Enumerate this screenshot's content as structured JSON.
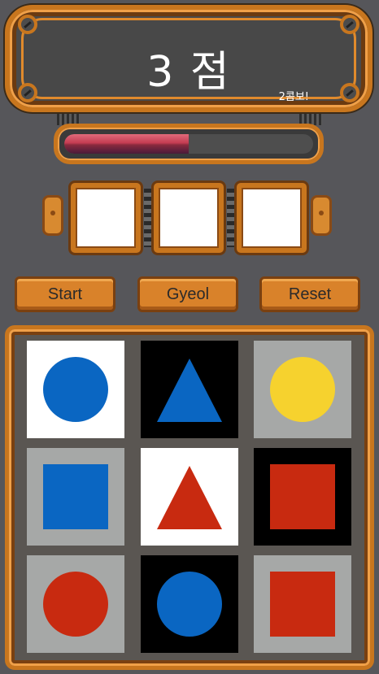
{
  "header": {
    "score": "3 점",
    "combo": "2콤보!"
  },
  "progress": {
    "fraction": 0.5,
    "fill_color": "#c43c52"
  },
  "slots": [
    "",
    "",
    ""
  ],
  "buttons": {
    "start": "Start",
    "gyeol": "Gyeol",
    "reset": "Reset"
  },
  "colors": {
    "white": "#ffffff",
    "black": "#000000",
    "gray": "#a6a8a7",
    "blue": "#0a66c2",
    "red": "#c82a10",
    "yellow": "#f6d22e"
  },
  "board": [
    {
      "bg": "white",
      "shape": "circle",
      "color": "blue"
    },
    {
      "bg": "black",
      "shape": "triangle",
      "color": "blue"
    },
    {
      "bg": "gray",
      "shape": "circle",
      "color": "yellow"
    },
    {
      "bg": "gray",
      "shape": "square",
      "color": "blue"
    },
    {
      "bg": "white",
      "shape": "triangle",
      "color": "red"
    },
    {
      "bg": "black",
      "shape": "square",
      "color": "red"
    },
    {
      "bg": "gray",
      "shape": "circle",
      "color": "red"
    },
    {
      "bg": "black",
      "shape": "circle",
      "color": "blue"
    },
    {
      "bg": "gray",
      "shape": "square",
      "color": "red"
    }
  ]
}
